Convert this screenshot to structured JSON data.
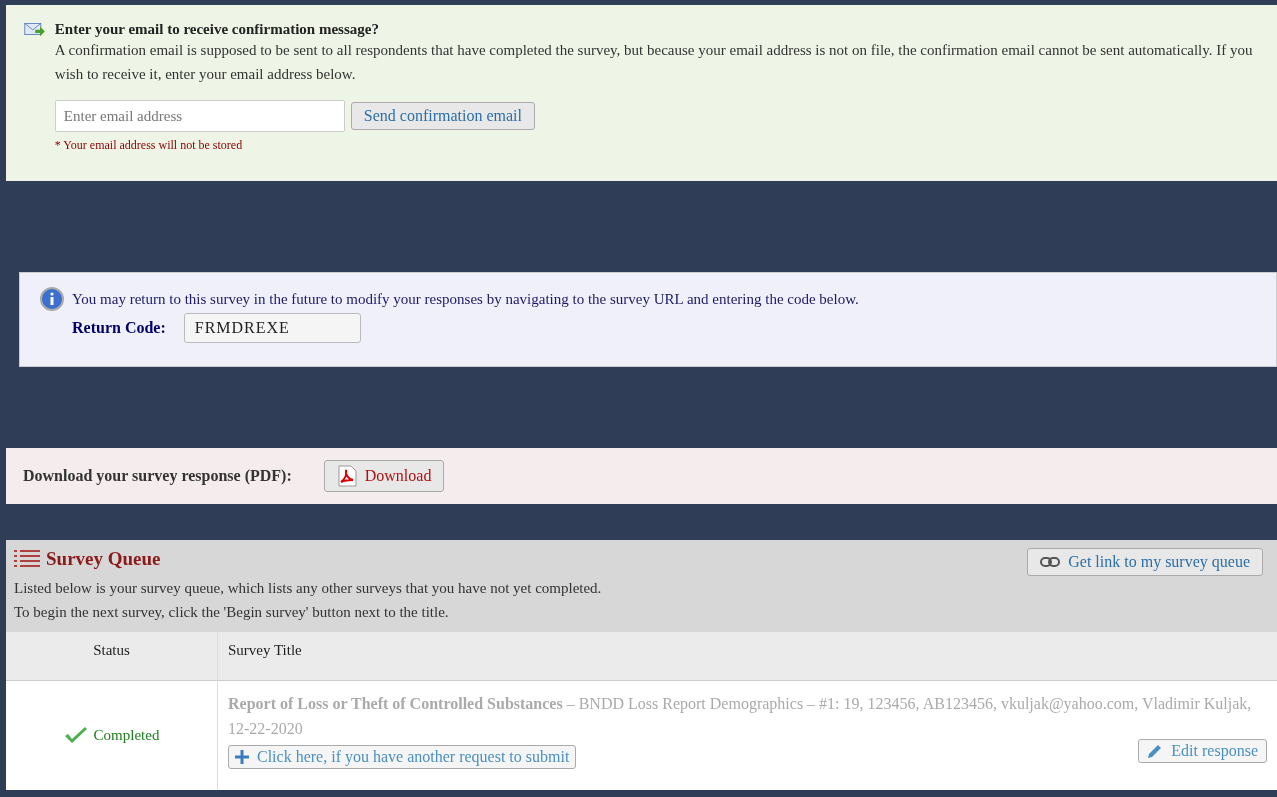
{
  "email_panel": {
    "title": "Enter your email to receive confirmation message?",
    "text": "A confirmation email is supposed to be sent to all respondents that have completed the survey, but because your email address is not on file, the confirmation email cannot be sent automatically. If you wish to receive it, enter your email address below.",
    "placeholder": "Enter email address",
    "button": "Send confirmation email",
    "note": "* Your email address will not be stored"
  },
  "return_panel": {
    "text": "You may return to this survey in the future to modify your responses by navigating to the survey URL and entering the code below.",
    "label": "Return Code:",
    "code": "FRMDREXE"
  },
  "download_panel": {
    "label": "Download your survey response (PDF):",
    "button": "Download"
  },
  "survey_queue": {
    "title": "Survey Queue",
    "link_button": "Get link to my survey queue",
    "lines": [
      "Listed below is your survey queue, which lists any other surveys that you have not yet completed.",
      "To begin the next survey, click the 'Begin survey' button next to the title."
    ],
    "columns": [
      "Status",
      "Survey Title"
    ],
    "rows": [
      {
        "status": "Completed",
        "title": "**Report of Loss or Theft of Controlled Substances**  –  BNDD Loss Report Demographics  – #1: 19, 123456, AB123456, vkuljak@yahoo.com, Vladimir Kuljak, 12-22-2020",
        "add_button": "Click here, if you have another request to submit",
        "edit_button": "Edit response"
      }
    ]
  }
}
